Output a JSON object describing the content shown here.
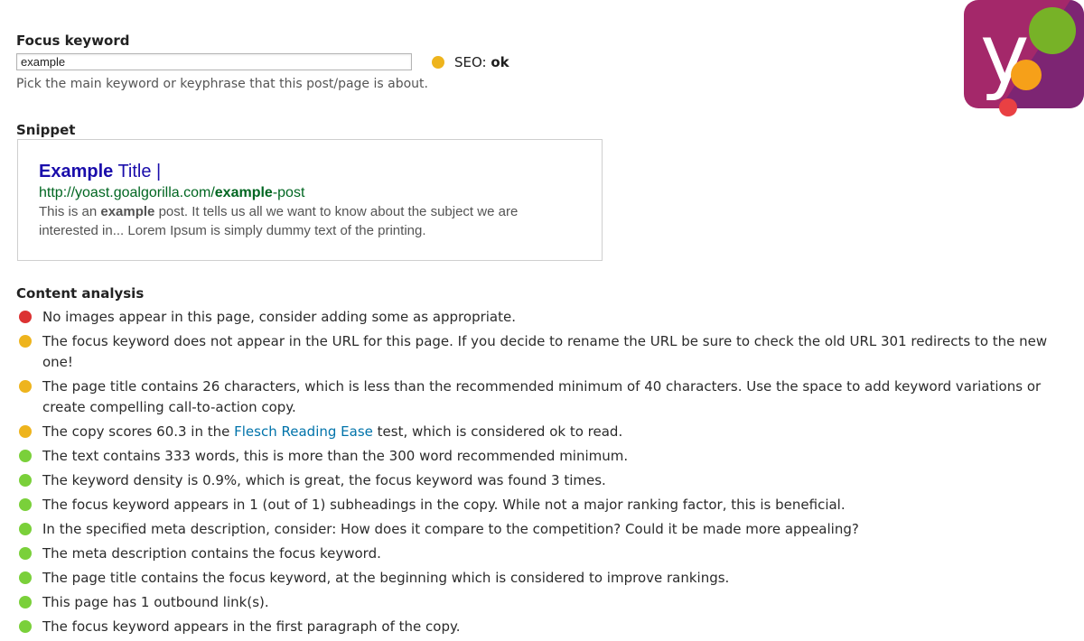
{
  "colors": {
    "red": "#dc3232",
    "orange": "#eeb41d",
    "green": "#7ad03a",
    "link": "#0073aa"
  },
  "focus_keyword": {
    "title": "Focus keyword",
    "value": "example",
    "help": "Pick the main keyword or keyphrase that this post/page is about.",
    "seo_prefix": "SEO: ",
    "seo_value": "ok",
    "seo_status_icon": "orange-dot-icon"
  },
  "snippet": {
    "title": "Snippet",
    "title_bold": "Example",
    "title_rest": " Title |",
    "url_prefix": "http://yoast.goalgorilla.com/",
    "url_bold": "example",
    "url_suffix": "-post",
    "desc_pre": "This is an ",
    "desc_bold": "example",
    "desc_post": " post. It tells us all we want to know about the subject we are interested in... Lorem Ipsum is simply dummy text of the printing."
  },
  "content_analysis": {
    "title": "Content analysis",
    "items": [
      {
        "status": "red",
        "text": "No images appear in this page, consider adding some as appropriate."
      },
      {
        "status": "orange",
        "text": "The focus keyword does not appear in the URL for this page. If you decide to rename the URL be sure to check the old URL 301 redirects to the new one!"
      },
      {
        "status": "orange",
        "text": "The page title contains 26 characters, which is less than the recommended minimum of 40 characters. Use the space to add keyword variations or create compelling call-to-action copy."
      },
      {
        "status": "orange",
        "pre": "The copy scores 60.3 in the ",
        "link": "Flesch Reading Ease",
        "post": " test, which is considered ok to read."
      },
      {
        "status": "green",
        "text": "The text contains 333 words, this is more than the 300 word recommended minimum."
      },
      {
        "status": "green",
        "text": "The keyword density is 0.9%, which is great, the focus keyword was found 3 times."
      },
      {
        "status": "green",
        "text": "The focus keyword appears in 1 (out of 1) subheadings in the copy. While not a major ranking factor, this is beneficial."
      },
      {
        "status": "green",
        "text": "In the specified meta description, consider: How does it compare to the competition? Could it be made more appealing?"
      },
      {
        "status": "green",
        "text": "The meta description contains the focus keyword."
      },
      {
        "status": "green",
        "text": "The page title contains the focus keyword, at the beginning which is considered to improve rankings."
      },
      {
        "status": "green",
        "text": "This page has 1 outbound link(s)."
      },
      {
        "status": "green",
        "text": "The focus keyword appears in the first paragraph of the copy."
      }
    ]
  },
  "logo": {
    "icon": "yoast-logo-icon",
    "glyph": "y"
  }
}
